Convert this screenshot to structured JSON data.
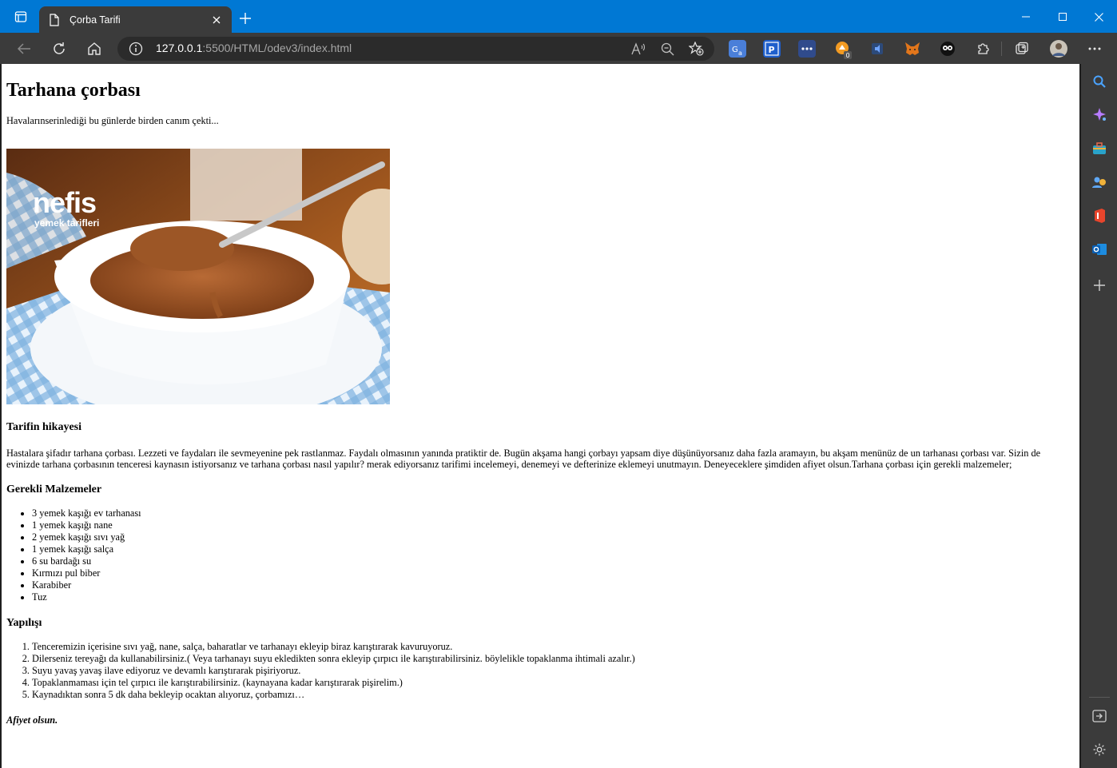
{
  "browser": {
    "tab_title": "Çorba Tarifi",
    "url_host": "127.0.0.1",
    "url_rest": ":5500/HTML/odev3/index.html"
  },
  "article": {
    "title": "Tarhana çorbası",
    "intro": "Havalarınserinlediği bu günlerde birden canım çekti...",
    "image_logo_main": "nefis",
    "image_logo_sub": "yemek tarifleri",
    "story_heading": "Tarifin hikayesi",
    "story_text": "Hastalara şifadır tarhana çorbası. Lezzeti ve faydaları ile sevmeyenine pek rastlanmaz. Faydalı olmasının yanında pratiktir de. Bugün akşama hangi çorbayı yapsam diye düşünüyorsanız daha fazla aramayın, bu akşam menünüz de un tarhanası çorbası var. Sizin de evinizde tarhana çorbasının tenceresi kaynasın istiyorsanız ve tarhana çorbası nasıl yapılır? merak ediyorsanız tarifimi incelemeyi, denemeyi ve defterinize eklemeyi unutmayın. Deneyeceklere şimdiden afiyet olsun.Tarhana çorbası için gerekli malzemeler;",
    "ingredients_heading": "Gerekli Malzemeler",
    "ingredients": [
      "3 yemek kaşığı ev tarhanası",
      "1 yemek kaşığı nane",
      "2 yemek kaşığı sıvı yağ",
      "1 yemek kaşığı salça",
      "6 su bardağı su",
      "Kırmızı pul biber",
      "Karabiber",
      "Tuz"
    ],
    "steps_heading": "Yapılışı",
    "steps": [
      "Tenceremizin içerisine sıvı yağ, nane, salça, baharatlar ve tarhanayı ekleyip biraz karıştırarak kavuruyoruz.",
      "Dilerseniz tereyağı da kullanabilirsiniz.( Veya tarhanayı suyu ekledikten sonra ekleyip çırpıcı ile karıştırabilirsiniz. böylelikle topaklanma ihtimali azalır.)",
      "Suyu yavaş yavaş ilave ediyoruz ve devamlı karıştırarak pişiriyoruz.",
      "Topaklanmaması için tel çırpıcı ile karıştırabilirsiniz. (kaynayana kadar karıştırarak pişirelim.)",
      "Kaynadıktan sonra 5 dk daha bekleyip ocaktan alıyoruz, çorbamızı…"
    ],
    "closing": "Afiyet olsun."
  }
}
